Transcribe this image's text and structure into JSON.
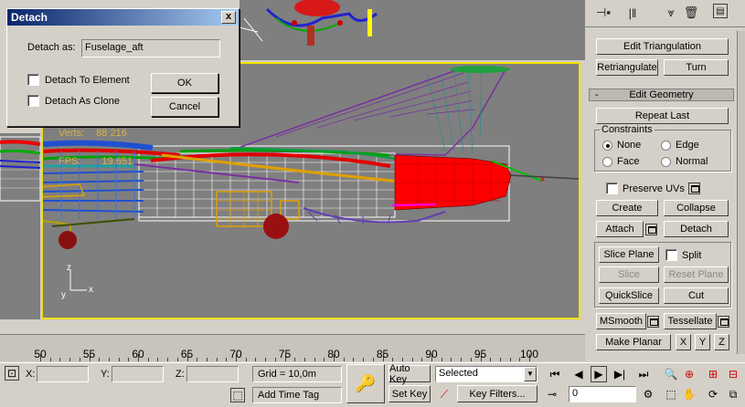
{
  "dialog": {
    "title": "Detach",
    "close": "x",
    "detach_as_label": "Detach as:",
    "detach_as_value": "Fuselage_aft",
    "to_element_label": "Detach To Element",
    "as_clone_label": "Detach As Clone",
    "ok_label": "OK",
    "cancel_label": "Cancel"
  },
  "viewport": {
    "verts_label": "Verts:",
    "verts_value": "88 216",
    "fps_label": "FPS:",
    "fps_value": "19.651",
    "axis_z": "z",
    "axis_x": "x",
    "axis_y": "y"
  },
  "panel": {
    "edit_triangulation": "Edit Triangulation",
    "retriangulate": "Retriangulate",
    "turn": "Turn",
    "rollout_toggle": "-",
    "rollout_title": "Edit Geometry",
    "repeat_last": "Repeat Last",
    "constraints_label": "Constraints",
    "none": "None",
    "edge": "Edge",
    "face": "Face",
    "normal": "Normal",
    "preserve_uvs": "Preserve UVs",
    "create": "Create",
    "collapse": "Collapse",
    "attach": "Attach",
    "detach": "Detach",
    "slice_plane": "Slice Plane",
    "split": "Split",
    "slice": "Slice",
    "reset_plane": "Reset Plane",
    "quickslice": "QuickSlice",
    "cut": "Cut",
    "msmooth": "MSmooth",
    "tessellate": "Tessellate",
    "make_planar": "Make Planar",
    "x": "X",
    "y": "Y",
    "z": "Z"
  },
  "timeline": {
    "ticks": [
      "50",
      "55",
      "60",
      "65",
      "70",
      "75",
      "80",
      "85",
      "90",
      "95",
      "100"
    ]
  },
  "status": {
    "x_label": "X:",
    "y_label": "Y:",
    "z_label": "Z:",
    "grid": "Grid = 10,0m",
    "add_time_tag": "Add Time Tag",
    "auto_key": "Auto Key",
    "set_key": "Set Key",
    "selected": "Selected",
    "key_filters": "Key Filters...",
    "frame": "0"
  },
  "colors": {
    "viewport_bg": "#7f7f7f",
    "active_border": "#f0e000",
    "stat_text": "#d6b24a",
    "selection_red": "#ff0000"
  }
}
